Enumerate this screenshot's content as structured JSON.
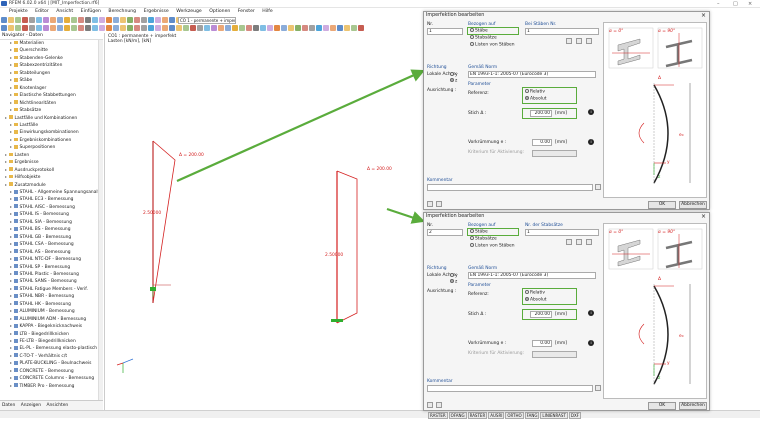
{
  "window": {
    "title": "RFEM 6.02.0 x64 | [MIT_Imperfection.rf6]",
    "controls": [
      "–",
      "□",
      "×"
    ]
  },
  "menu": [
    "Projekte",
    "Editor",
    "Ansicht",
    "Einfügen",
    "Berechnung",
    "Ergebnisse",
    "Werkzeuge",
    "Optionen",
    "Fenster",
    "Hilfe"
  ],
  "toolbar": {
    "load_case": "LF1 - ohne Lasten",
    "combo_text": "CO 1 - permanente + imperfekt"
  },
  "navigator": {
    "title": "Navigator - Daten",
    "items": [
      {
        "label": "Materialien",
        "indent": 2,
        "icon": "folder"
      },
      {
        "label": "Querschnitte",
        "indent": 2,
        "icon": "folder"
      },
      {
        "label": "Stabenden-Gelenke",
        "indent": 2,
        "icon": "folder"
      },
      {
        "label": "Stabexzentrizitäten",
        "indent": 2,
        "icon": "folder"
      },
      {
        "label": "Stabteilungen",
        "indent": 2,
        "icon": "folder"
      },
      {
        "label": "Stäbe",
        "indent": 2,
        "icon": "folder"
      },
      {
        "label": "Knotenlager",
        "indent": 2,
        "icon": "folder"
      },
      {
        "label": "Elastische Stabbettungen",
        "indent": 2,
        "icon": "folder"
      },
      {
        "label": "Nichtlinearitäten",
        "indent": 2,
        "icon": "folder"
      },
      {
        "label": "Stabsätze",
        "indent": 2,
        "icon": "folder"
      },
      {
        "label": "Lastfälle und Kombinationen",
        "indent": 1,
        "icon": "folder"
      },
      {
        "label": "Lastfälle",
        "indent": 2,
        "icon": "folder"
      },
      {
        "label": "Einwirkungskombinationen",
        "indent": 2,
        "icon": "folder"
      },
      {
        "label": "Ergebniskombinationen",
        "indent": 2,
        "icon": "folder"
      },
      {
        "label": "Superpositionen",
        "indent": 2,
        "icon": "folder"
      },
      {
        "label": "Lasten",
        "indent": 1,
        "icon": "folder"
      },
      {
        "label": "Ergebnisse",
        "indent": 1,
        "icon": "folder"
      },
      {
        "label": "Ausdruckprotokoll",
        "indent": 1,
        "icon": "folder"
      },
      {
        "label": "Hilfsobjekte",
        "indent": 1,
        "icon": "folder"
      },
      {
        "label": "Zusatzmodule",
        "indent": 1,
        "icon": "folder"
      },
      {
        "label": "STAHL - Allgemeine Spannungsanalyse",
        "indent": 2,
        "icon": "module"
      },
      {
        "label": "STAHL EC3 - Bemessung",
        "indent": 2,
        "icon": "module"
      },
      {
        "label": "STAHL AISC - Bemessung",
        "indent": 2,
        "icon": "module"
      },
      {
        "label": "STAHL IS - Bemessung",
        "indent": 2,
        "icon": "module"
      },
      {
        "label": "STAHL SIA - Bemessung",
        "indent": 2,
        "icon": "module"
      },
      {
        "label": "STAHL BS - Bemessung",
        "indent": 2,
        "icon": "module"
      },
      {
        "label": "STAHL GB - Bemessung",
        "indent": 2,
        "icon": "module"
      },
      {
        "label": "STAHL CSA - Bemessung",
        "indent": 2,
        "icon": "module"
      },
      {
        "label": "STAHL AS - Bemessung",
        "indent": 2,
        "icon": "module"
      },
      {
        "label": "STAHL NTC-DF - Bemessung",
        "indent": 2,
        "icon": "module"
      },
      {
        "label": "STAHL SP - Bemessung",
        "indent": 2,
        "icon": "module"
      },
      {
        "label": "STAHL Plastic - Bemessung",
        "indent": 2,
        "icon": "module"
      },
      {
        "label": "STAHL SANS - Bemessung",
        "indent": 2,
        "icon": "module"
      },
      {
        "label": "STAHL Fatigue Members - Verif.",
        "indent": 2,
        "icon": "module"
      },
      {
        "label": "STAHL NBR - Bemessung",
        "indent": 2,
        "icon": "module"
      },
      {
        "label": "STAHL HK - Bemessung",
        "indent": 2,
        "icon": "module"
      },
      {
        "label": "ALUMINIUM - Bemessung",
        "indent": 2,
        "icon": "module"
      },
      {
        "label": "ALUMINIUM ADM - Bemessung",
        "indent": 2,
        "icon": "module"
      },
      {
        "label": "KAPPA - Biegeknicknachweis",
        "indent": 2,
        "icon": "module"
      },
      {
        "label": "LTB - Biegedrillknicken",
        "indent": 2,
        "icon": "module"
      },
      {
        "label": "FE-LTB - Biegedrillknicken",
        "indent": 2,
        "icon": "module"
      },
      {
        "label": "EL-PL - Bemessung elasto-plastisch",
        "indent": 2,
        "icon": "module"
      },
      {
        "label": "C-TO-T - Verhältnis c/t",
        "indent": 2,
        "icon": "module"
      },
      {
        "label": "PLATE-BUCKLING - Beulnachweis",
        "indent": 2,
        "icon": "module"
      },
      {
        "label": "CONCRETE - Bemessung",
        "indent": 2,
        "icon": "module"
      },
      {
        "label": "CONCRETE Columns - Bemessung",
        "indent": 2,
        "icon": "module"
      },
      {
        "label": "TIMBER Pro - Bemessung",
        "indent": 2,
        "icon": "module"
      }
    ],
    "tabs": [
      "Daten",
      "Anzeigen",
      "Ansichten"
    ]
  },
  "viewport": {
    "line1": "CO1 : permanente + imperfekt",
    "line2": "Lasten [kN/m], [kN]",
    "label_top1": "Δ = 200.00",
    "label_top2": "Δ = 200.00",
    "label_mid1": "2.50000",
    "label_mid2": "2.50000"
  },
  "status_chips": [
    "RASTER",
    "OFANG",
    "RASTER",
    "AUSRI",
    "ORTHO",
    "FANG",
    "LINIENRAST",
    "DXF"
  ],
  "dialog1": {
    "title": "Imperfektion bearbeiten",
    "no_label": "Nr.",
    "no_value": "1",
    "relation_label": "Bezogen auf",
    "relation_opts": [
      "Stäbe",
      "Stabsätze",
      "Listen von Stäben"
    ],
    "members_label": "Bei Stäben Nr.",
    "members_value": "1",
    "direction_label": "Richtung",
    "axis_label": "Lokale Achse:",
    "axes": [
      "y",
      "z"
    ],
    "sign_label": "Ausrichtung :",
    "code_label": "Gemäß Norm",
    "code_value": "EN 1993-1-1: 2005-07 (Eurocode 3)",
    "params_label": "Parameter",
    "reference_label": "Referenz:",
    "relative": "Relativ",
    "absolute": "Absolut",
    "incl_label": "Stich Δ :",
    "incl_value": "200.00",
    "unit": "[mm]",
    "precamber_label": "Vorkrümmung e :",
    "precamber_value": "0.00",
    "unit2": "[mm]",
    "active_label": "Kriterium für Aktivierung:",
    "comment_label": "Kommentar",
    "ok": "OK",
    "cancel": "Abbrechen"
  },
  "dialog2": {
    "title": "Imperfektion bearbeiten",
    "no_label": "Nr.",
    "no_value": "2",
    "relation_label": "Bezogen auf",
    "relation_opts": [
      "Stäbe",
      "Stabsätze",
      "Listen von Stäben"
    ],
    "members_label": "Nr. der Stabsätze",
    "members_value": "1",
    "direction_label": "Richtung",
    "axis_label": "Lokale Achse:",
    "axes": [
      "y",
      "z"
    ],
    "sign_label": "Ausrichtung :",
    "code_label": "Gemäß Norm",
    "code_value": "EN 1993-1-1: 2005-07 (Eurocode 3)",
    "params_label": "Parameter",
    "reference_label": "Referenz:",
    "relative": "Relativ",
    "absolute": "Absolut",
    "incl_label": "Stich Δ :",
    "incl_value": "200.00",
    "unit": "[mm]",
    "precamber_label": "Vorkrümmung e :",
    "precamber_value": "0.00",
    "unit2": "[mm]",
    "active_label": "Kriterium für Aktivierung:",
    "comment_label": "Kommentar",
    "ok": "OK",
    "cancel": "Abbrechen"
  },
  "diagram_labels": {
    "a": "α = 0°",
    "b": "α = 90°",
    "c": "Δ",
    "d": "e₀",
    "e": "y",
    "f": "z"
  },
  "colors": {
    "accent": "#5aac3c",
    "imperf": "#d42020",
    "section": "#1f4e96"
  }
}
